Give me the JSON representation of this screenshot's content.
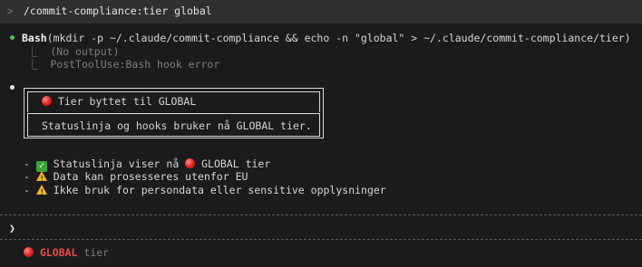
{
  "command_bar": {
    "caret": ">",
    "text": "/commit-compliance:tier global"
  },
  "tool_call": {
    "tool_name": "Bash",
    "args": "(mkdir -p ~/.claude/commit-compliance && echo -n \"global\" > ~/.claude/commit-compliance/tier)",
    "output_lines": [
      "⎿  (No output)",
      "⎿  PostToolUse:Bash hook error"
    ]
  },
  "result_box": {
    "title": "Tier byttet til GLOBAL",
    "body": "Statuslinja og hooks bruker nå GLOBAL tier."
  },
  "bullets": [
    {
      "prefix": "- ",
      "icon": "check-icon",
      "text_before": " Statuslinja viser nå ",
      "icon2": "red-circle-icon",
      "text_after": " GLOBAL tier"
    },
    {
      "prefix": "- ",
      "icon": "warning-icon",
      "text": " Data kan prosesseres utenfor EU"
    },
    {
      "prefix": "- ",
      "icon": "warning-icon",
      "text": " Ikke bruk for persondata eller sensitive opplysninger"
    }
  ],
  "input": {
    "prompt_symbol": "❯",
    "value": ""
  },
  "status": {
    "tier_label": "GLOBAL",
    "suffix": " tier"
  },
  "colors": {
    "background": "#1b1b1b",
    "bash_dot": "#4cc24c",
    "global_text": "#e84a4a"
  }
}
